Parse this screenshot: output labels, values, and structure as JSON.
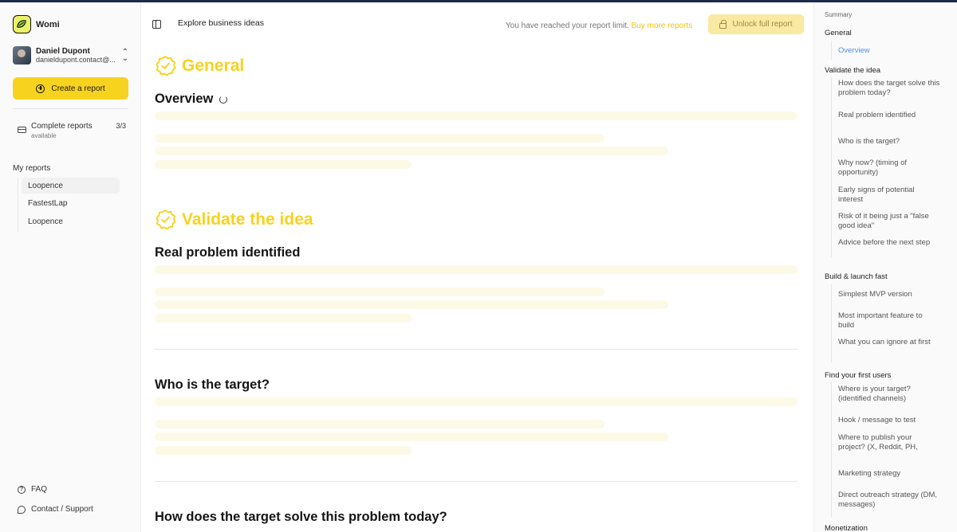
{
  "app": {
    "name": "Womi"
  },
  "user": {
    "name": "Daniel Dupont",
    "email": "danieldupont.contact@..."
  },
  "sidebar": {
    "create_button": "Create a report",
    "reports_available": {
      "label": "Complete reports",
      "sub": "available",
      "count": "3/3"
    },
    "my_reports_title": "My reports",
    "my_reports": [
      "Loopence",
      "FastestLap",
      "Loopence"
    ],
    "faq": "FAQ",
    "support": "Contact / Support"
  },
  "header": {
    "title": "Explore business ideas",
    "limit_text": "You have reached your report limit.",
    "limit_link": "Buy more reports",
    "unlock_button": "Unlock full report"
  },
  "main": {
    "sections": [
      {
        "title": "General"
      },
      {
        "title": "Validate the idea"
      }
    ],
    "subsections": [
      "Overview",
      "Real problem identified",
      "Who is the target?",
      "How does the target solve this problem today?"
    ]
  },
  "summary": {
    "title": "Summary",
    "groups": [
      {
        "label": "General",
        "items": [
          "Overview"
        ]
      },
      {
        "label": "Validate the idea",
        "items": [
          "How does the target solve this problem today?",
          "Real problem identified",
          "Who is the target?",
          "Why now? (timing of opportunity)",
          "Early signs of potential interest",
          "Risk of it being just a \"false good idea\"",
          "Advice before the next step"
        ]
      },
      {
        "label": "Build & launch fast",
        "items": [
          "Simplest MVP version",
          "Most important feature to build",
          "What you can ignore at first"
        ]
      },
      {
        "label": "Find your first users",
        "items": [
          "Where is your target? (identified channels)",
          "Hook / message to test",
          "Where to publish your project? (X, Reddit, PH,",
          "Marketing strategy",
          "Direct outreach strategy (DM, messages)"
        ]
      },
      {
        "label": "Monetization",
        "items": []
      }
    ]
  },
  "colors": {
    "accent": "#f7d21e",
    "link_active": "#4f8fe3",
    "skeleton": "#fcfae6",
    "unlock_bg": "#fae9a2"
  }
}
